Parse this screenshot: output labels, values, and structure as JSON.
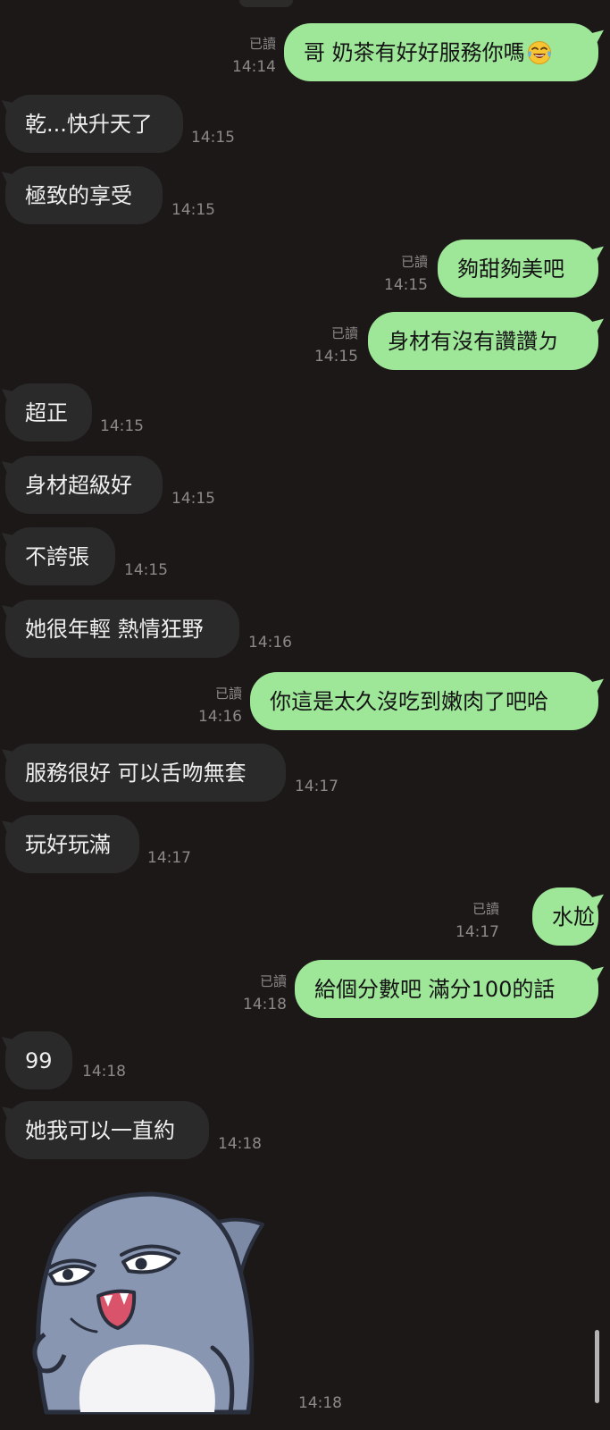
{
  "read_label": "已讀",
  "messages": [
    {
      "dir": "out",
      "text": "哥 奶茶有好好服務你嗎",
      "emoji": "face-with-tears-of-joy",
      "read": "已讀",
      "time": "14:14"
    },
    {
      "dir": "in",
      "text": "乾...快升天了",
      "time": "14:15"
    },
    {
      "dir": "in",
      "text": "極致的享受",
      "time": "14:15"
    },
    {
      "dir": "out",
      "text": "夠甜夠美吧",
      "read": "已讀",
      "time": "14:15"
    },
    {
      "dir": "out",
      "text": "身材有沒有讚讚ㄉ",
      "read": "已讀",
      "time": "14:15"
    },
    {
      "dir": "in",
      "text": "超正",
      "time": "14:15"
    },
    {
      "dir": "in",
      "text": "身材超級好",
      "time": "14:15"
    },
    {
      "dir": "in",
      "text": "不誇張",
      "time": "14:15"
    },
    {
      "dir": "in",
      "text": "她很年輕 熱情狂野",
      "time": "14:16"
    },
    {
      "dir": "out",
      "text": "你這是太久沒吃到嫩肉了吧哈",
      "read": "已讀",
      "time": "14:16"
    },
    {
      "dir": "in",
      "text": "服務很好 可以舌吻無套",
      "time": "14:17"
    },
    {
      "dir": "in",
      "text": "玩好玩滿",
      "time": "14:17"
    },
    {
      "dir": "out",
      "text": "水尬",
      "read": "已讀",
      "time": "14:17"
    },
    {
      "dir": "out",
      "text": "給個分數吧 滿分100的話",
      "read": "已讀",
      "time": "14:18"
    },
    {
      "dir": "in",
      "text": "99",
      "time": "14:18"
    },
    {
      "dir": "in",
      "text": "她我可以一直約",
      "time": "14:18"
    },
    {
      "dir": "in",
      "type": "sticker",
      "sticker": "smirking-shark-sticker",
      "time": "14:18"
    }
  ],
  "colors": {
    "background": "#1b1817",
    "incoming_bubble": "#2b2a2a",
    "outgoing_bubble": "#9ee698",
    "incoming_text": "#efefef",
    "outgoing_text": "#141414",
    "meta_text": "#8c8a89",
    "scrollbar": "#b4b4b4"
  }
}
